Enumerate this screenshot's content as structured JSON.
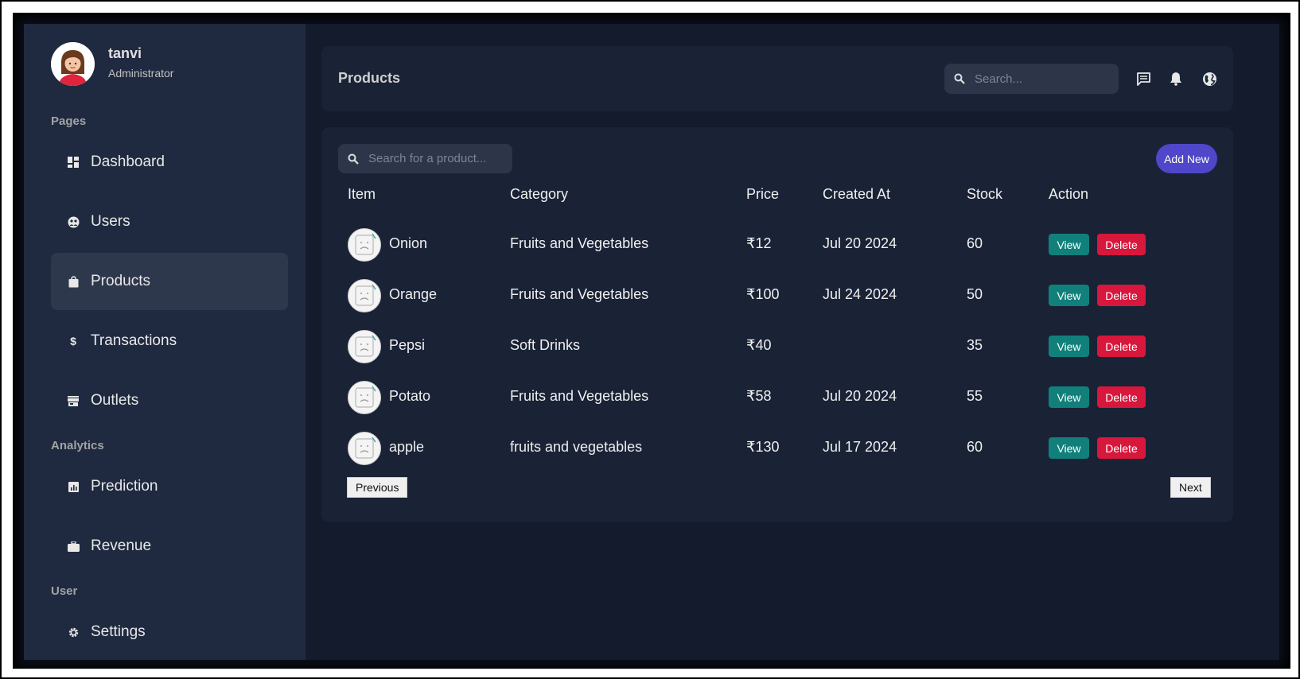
{
  "user": {
    "name": "tanvi",
    "role": "Administrator"
  },
  "sidebar": {
    "sections": [
      {
        "label": "Pages"
      },
      {
        "label": "Analytics"
      },
      {
        "label": "User"
      }
    ],
    "items": [
      {
        "label": "Dashboard",
        "icon": "dashboard-icon"
      },
      {
        "label": "Users",
        "icon": "users-icon"
      },
      {
        "label": "Products",
        "icon": "shopping-bag-icon",
        "active": true
      },
      {
        "label": "Transactions",
        "icon": "dollar-icon"
      },
      {
        "label": "Outlets",
        "icon": "store-icon"
      },
      {
        "label": "Prediction",
        "icon": "chart-icon"
      },
      {
        "label": "Revenue",
        "icon": "briefcase-icon"
      },
      {
        "label": "Settings",
        "icon": "gear-icon"
      }
    ]
  },
  "header": {
    "title": "Products",
    "search_placeholder": "Search..."
  },
  "products": {
    "search_placeholder": "Search for a product...",
    "add_label": "Add New",
    "columns": [
      "Item",
      "Category",
      "Price",
      "Created At",
      "Stock",
      "Action"
    ],
    "rows": [
      {
        "item": "Onion",
        "category": "Fruits and Vegetables",
        "price": "₹12",
        "created": "Jul 20 2024",
        "stock": "60"
      },
      {
        "item": "Orange",
        "category": "Fruits and Vegetables",
        "price": "₹100",
        "created": "Jul 24 2024",
        "stock": "50"
      },
      {
        "item": "Pepsi",
        "category": "Soft Drinks",
        "price": "₹40",
        "created": "",
        "stock": "35"
      },
      {
        "item": "Potato",
        "category": "Fruits and Vegetables",
        "price": "₹58",
        "created": "Jul 20 2024",
        "stock": "55"
      },
      {
        "item": "apple",
        "category": "fruits and vegetables",
        "price": "₹130",
        "created": "Jul 17 2024",
        "stock": "60"
      }
    ],
    "view_label": "View",
    "delete_label": "Delete",
    "prev_label": "Previous",
    "next_label": "Next"
  },
  "colors": {
    "background": "#141b2d",
    "sidebar": "#1f2a40",
    "panel": "#1a2236",
    "accent": "#5046c9",
    "view": "#11807a",
    "delete": "#d8173c"
  }
}
